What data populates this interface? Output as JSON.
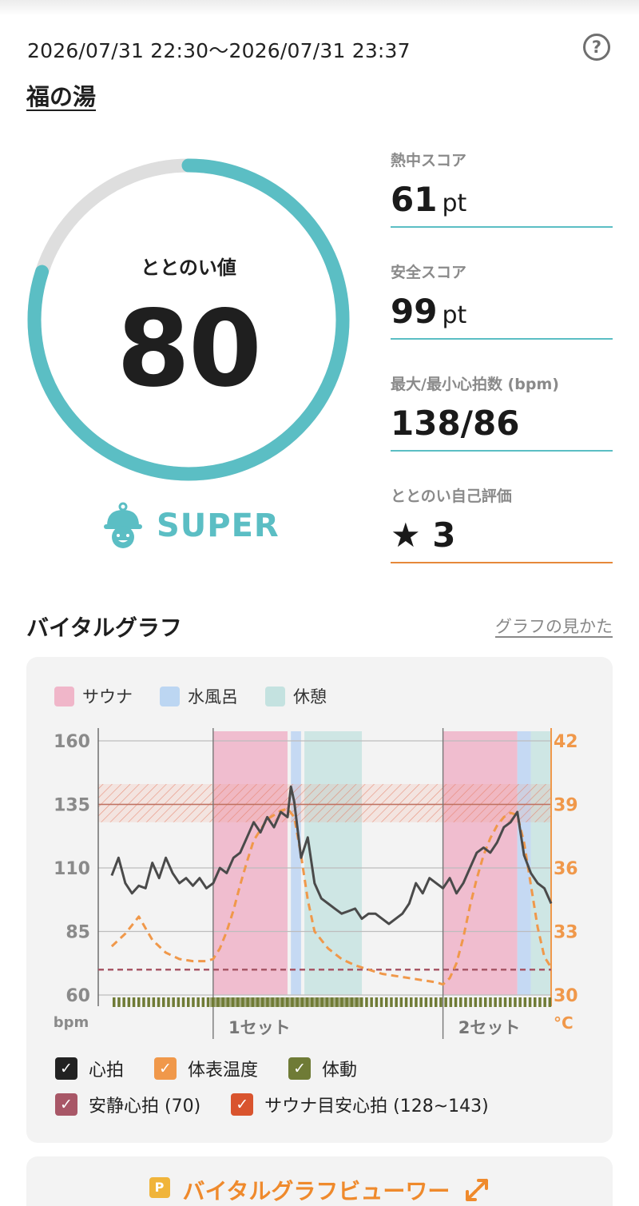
{
  "session": {
    "date_range": "2026/07/31 22:30～2026/07/31 23:37",
    "facility_name": "福の湯"
  },
  "totonoi": {
    "label": "ととのい値",
    "value": "80",
    "ratio": 0.8,
    "rank": "SUPER",
    "rank_icon": "helmet-mascot-icon"
  },
  "stats": [
    {
      "label": "熱中スコア",
      "value": "61",
      "unit": "pt"
    },
    {
      "label": "安全スコア",
      "value": "99",
      "unit": "pt"
    },
    {
      "label": "最大/最小心拍数 (bpm)",
      "value": "138/86",
      "unit": ""
    },
    {
      "label": "ととのい自己評価",
      "value": "★ 3",
      "unit": ""
    }
  ],
  "vital_graph": {
    "title": "バイタルグラフ",
    "howto_link": "グラフの見かた",
    "legend": [
      {
        "label": "サウナ",
        "color": "#f0b6c9"
      },
      {
        "label": "水風呂",
        "color": "#bcd6f2"
      },
      {
        "label": "休憩",
        "color": "#c4e2e0"
      }
    ],
    "left_ticks": [
      "160",
      "135",
      "110",
      "85",
      "60"
    ],
    "left_unit": "bpm",
    "right_ticks": [
      "42",
      "39",
      "36",
      "33",
      "30"
    ],
    "right_unit": "°C",
    "set_labels": [
      "1セット",
      "2セット"
    ],
    "checkboxes": [
      {
        "label": "心拍",
        "color": "#222222"
      },
      {
        "label": "体表温度",
        "color": "#f0984a"
      },
      {
        "label": "体動",
        "color": "#6f7b36"
      },
      {
        "label": "安静心拍 (70)",
        "color": "#a85767"
      },
      {
        "label": "サウナ目安心拍 (128~143)",
        "color": "#d9542e"
      }
    ]
  },
  "chart_data": {
    "type": "line",
    "x_unit": "minutes from 22:30",
    "xlim": [
      0,
      67
    ],
    "left_axis": {
      "label": "bpm",
      "ylim": [
        60,
        160
      ],
      "ticks": [
        160,
        135,
        110,
        85,
        60
      ]
    },
    "right_axis": {
      "label": "°C",
      "ylim": [
        30,
        42
      ],
      "ticks": [
        42,
        39,
        36,
        33,
        30
      ]
    },
    "phases": [
      {
        "type": "sauna",
        "start": 17,
        "end": 28
      },
      {
        "type": "water",
        "start": 28.5,
        "end": 30
      },
      {
        "type": "rest",
        "start": 30.5,
        "end": 39
      },
      {
        "type": "sauna",
        "start": 51,
        "end": 62
      },
      {
        "type": "water",
        "start": 62,
        "end": 64
      },
      {
        "type": "rest",
        "start": 64,
        "end": 67
      }
    ],
    "set_markers": [
      {
        "label": "1セット",
        "x": 17
      },
      {
        "label": "2セット",
        "x": 51
      }
    ],
    "resting_hr": 70,
    "sauna_target_hr": [
      128,
      143
    ],
    "series": [
      {
        "name": "心拍",
        "axis": "left",
        "x": [
          2,
          3,
          4,
          5,
          6,
          7,
          8,
          9,
          10,
          11,
          12,
          13,
          14,
          15,
          16,
          17,
          18,
          19,
          20,
          21,
          22,
          23,
          24,
          25,
          26,
          27,
          28,
          28.5,
          29,
          30,
          31,
          32,
          33,
          34,
          35,
          36,
          37,
          38,
          39,
          40,
          41,
          42,
          43,
          44,
          45,
          46,
          47,
          48,
          49,
          50,
          51,
          52,
          53,
          54,
          55,
          56,
          57,
          58,
          59,
          60,
          61,
          62,
          63,
          64,
          65,
          66,
          67
        ],
        "values": [
          107,
          114,
          104,
          100,
          103,
          102,
          112,
          106,
          114,
          108,
          104,
          106,
          103,
          106,
          102,
          104,
          110,
          108,
          114,
          116,
          122,
          128,
          124,
          130,
          126,
          132,
          130,
          142,
          136,
          114,
          122,
          104,
          98,
          96,
          94,
          92,
          93,
          94,
          90,
          92,
          92,
          90,
          88,
          90,
          92,
          96,
          104,
          100,
          106,
          104,
          102,
          106,
          100,
          104,
          110,
          116,
          118,
          116,
          120,
          126,
          128,
          132,
          115,
          108,
          104,
          102,
          96
        ]
      },
      {
        "name": "体表温度",
        "axis": "right",
        "x": [
          2,
          4,
          6,
          8,
          10,
          12,
          14,
          16,
          17,
          18,
          19,
          20,
          21,
          22,
          23,
          24,
          25,
          26,
          27,
          28,
          29,
          30,
          31,
          32,
          34,
          36,
          38,
          40,
          42,
          44,
          46,
          48,
          50,
          51,
          52,
          53,
          54,
          55,
          56,
          57,
          58,
          59,
          60,
          61,
          62,
          63,
          64,
          65,
          66,
          67
        ],
        "values": [
          32.3,
          32.9,
          33.7,
          32.6,
          32.0,
          31.7,
          31.6,
          31.6,
          31.7,
          32.2,
          33.0,
          34.0,
          35.2,
          36.3,
          37.3,
          37.8,
          38.3,
          38.5,
          38.7,
          38.8,
          38.4,
          36.6,
          34.5,
          33.0,
          32.2,
          31.7,
          31.4,
          31.2,
          31.0,
          30.9,
          30.8,
          30.7,
          30.6,
          30.5,
          30.8,
          31.5,
          32.7,
          34.2,
          35.5,
          36.6,
          37.4,
          38.0,
          38.4,
          38.6,
          38.5,
          37.2,
          35.2,
          33.2,
          31.8,
          31.3
        ]
      },
      {
        "name": "体動",
        "axis": "none",
        "note": "dense activity ticks along baseline"
      }
    ]
  },
  "viewer": {
    "badge": "P",
    "label": "バイタルグラフビューワー",
    "icon": "expand-arrows-icon"
  }
}
